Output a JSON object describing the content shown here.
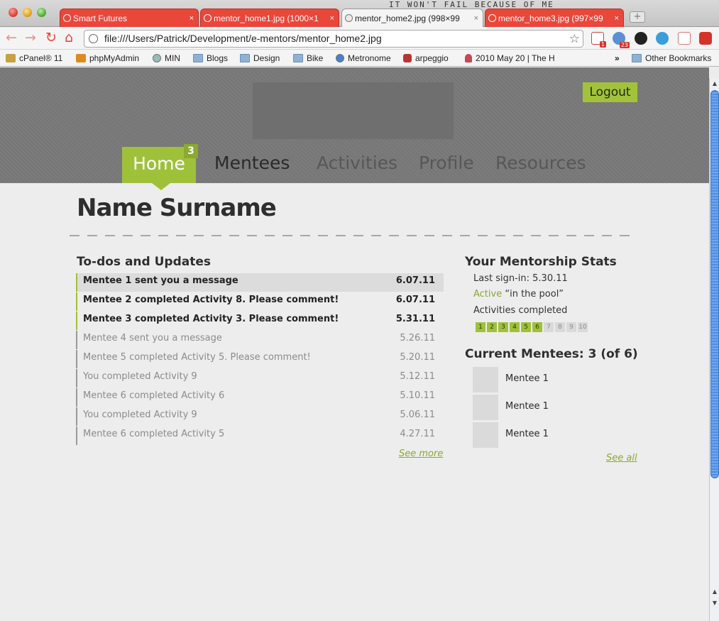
{
  "browser": {
    "tabs": [
      {
        "label": "Smart Futures",
        "active": false
      },
      {
        "label": "mentor_home1.jpg (1000×1",
        "active": false
      },
      {
        "label": "mentor_home2.jpg (998×99",
        "active": true
      },
      {
        "label": "mentor_home3.jpg (997×99",
        "active": false
      }
    ],
    "new_tab_glyph": "+",
    "close_glyph": "×",
    "background_text": "IT WON'T FAIL BECAUSE OF ME",
    "url": "file:///Users/Patrick/Development/e-mentors/mentor_home2.jpg",
    "gmail_badge": "1",
    "calendar_badge": "23",
    "bookmarks": [
      "cPanel® 11",
      "phpMyAdmin",
      "MIN",
      "Blogs",
      "Design",
      "Bike",
      "Metronome",
      "arpeggio",
      "2010 May 20 | The H"
    ],
    "bookmarks_more": "»",
    "other_bookmarks": "Other Bookmarks"
  },
  "header": {
    "logout_label": "Logout",
    "nav": [
      {
        "label": "Home",
        "active": true,
        "badge": "3"
      },
      {
        "label": "Mentees",
        "active": false
      },
      {
        "label": "Activities",
        "active": false
      },
      {
        "label": "Profile",
        "active": false
      },
      {
        "label": "Resources",
        "active": false
      }
    ]
  },
  "page": {
    "title": "Name Surname"
  },
  "todos": {
    "heading": "To-dos and Updates",
    "items": [
      {
        "text": "Mentee 1 sent you a message",
        "date": "6.07.11",
        "unread": true
      },
      {
        "text": "Mentee 2 completed Activity 8. Please comment!",
        "date": "6.07.11",
        "unread": true
      },
      {
        "text": "Mentee 3 completed Activity 3. Please comment!",
        "date": "5.31.11",
        "unread": true
      },
      {
        "text": "Mentee 4 sent you a message",
        "date": "5.26.11",
        "unread": false
      },
      {
        "text": "Mentee 5 completed Activity 5. Please comment!",
        "date": "5.20.11",
        "unread": false
      },
      {
        "text": "You completed Activity 9",
        "date": "5.12.11",
        "unread": false
      },
      {
        "text": "Mentee 6 completed Activity 6",
        "date": "5.10.11",
        "unread": false
      },
      {
        "text": "You completed Activity 9",
        "date": "5.06.11",
        "unread": false
      },
      {
        "text": "Mentee 6 completed Activity 5",
        "date": "4.27.11",
        "unread": false
      }
    ],
    "see_more": "See more"
  },
  "stats": {
    "heading": "Your Mentorship Stats",
    "last_signin": "Last sign-in: 5.30.11",
    "status_word": "Active",
    "status_rest": " “in the pool”",
    "activities_label": "Activities completed",
    "activities": [
      "1",
      "2",
      "3",
      "4",
      "5",
      "6",
      "7",
      "8",
      "9",
      "10"
    ],
    "activities_completed": 6
  },
  "mentees": {
    "heading": "Current Mentees: 3 (of 6)",
    "items": [
      "Mentee 1",
      "Mentee 1",
      "Mentee 1"
    ],
    "see_all": "See all"
  }
}
